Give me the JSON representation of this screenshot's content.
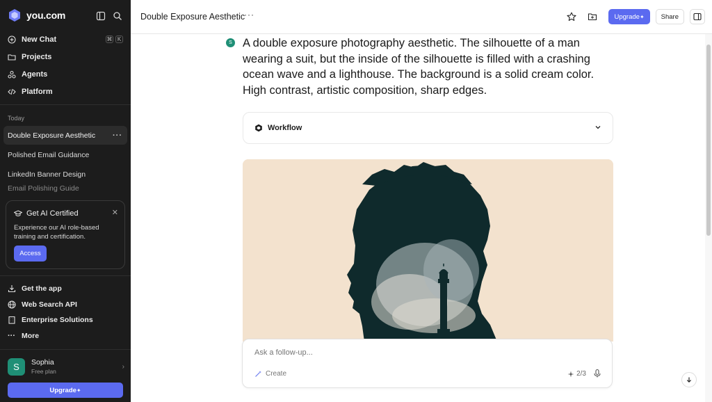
{
  "sidebar": {
    "brand": "you.com",
    "nav": [
      {
        "label": "New Chat",
        "icon": "plus-circle-icon"
      },
      {
        "label": "Projects",
        "icon": "folder-icon"
      },
      {
        "label": "Agents",
        "icon": "agents-icon"
      },
      {
        "label": "Platform",
        "icon": "code-icon"
      }
    ],
    "shortcut": [
      "⌘",
      "K"
    ],
    "section_today": "Today",
    "history": [
      "Double Exposure Aesthetic",
      "Polished Email Guidance",
      "LinkedIn Banner Design",
      "Email Polishing Guide"
    ],
    "promo": {
      "title": "Get AI Certified",
      "text": "Experience our AI role-based training and certification.",
      "button": "Access"
    },
    "links": [
      "Get the app",
      "Web Search API",
      "Enterprise Solutions",
      "More"
    ],
    "user": {
      "initial": "S",
      "name": "Sophia",
      "plan": "Free plan"
    },
    "upgrade": "Upgrade"
  },
  "header": {
    "title": "Double Exposure Aesthetic",
    "upgrade": "Upgrade",
    "share": "Share"
  },
  "main": {
    "avatar_initial": "S",
    "prompt": "A double exposure photography aesthetic. The silhouette of a man wearing a suit, but the inside of the silhouette is filled with a crashing ocean wave and a lighthouse. The background is a solid cream color. High contrast, artistic composition, sharp edges.",
    "workflow_label": "Workflow",
    "input_placeholder": "Ask a follow-up...",
    "create_label": "Create",
    "counter": "2/3"
  },
  "colors": {
    "accent": "#5b6af0",
    "sidebar_bg": "#1c1c1c",
    "avatar": "#1f8f76",
    "image_bg": "#f3e2ce"
  }
}
